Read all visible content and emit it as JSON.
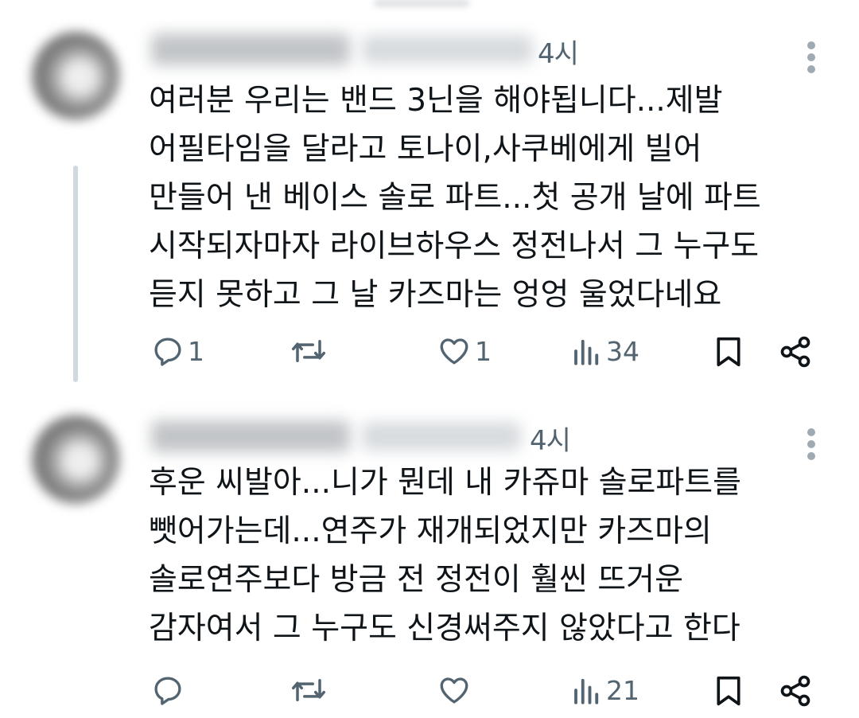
{
  "tweets": [
    {
      "time": "4시",
      "text_lines": [
        "여러분 우리는 밴드 3닌을 해야됩니다...제발",
        "어필타임을 달라고 토나이,사쿠베에게 빌어",
        "만들어 낸 베이스 솔로 파트...첫 공개 날에 파트",
        "시작되자마자 라이브하우스 정전나서 그 누구도",
        "듣지 못하고 그 날 카즈마는 엉엉 울었다네요"
      ],
      "actions": {
        "reply_count": "1",
        "retweet_count": "",
        "like_count": "1",
        "views_count": "34"
      }
    },
    {
      "time": "4시",
      "text_lines": [
        "후운 씨발아...니가 뭔데 내 카쥬마 솔로파트를",
        "뺏어가는데...연주가 재개되었지만 카즈마의",
        "솔로연주보다 방금 전 정전이 훨씬 뜨거운",
        "감자여서 그 누구도 신경써주지 않았다고 한다"
      ],
      "actions": {
        "reply_count": "",
        "retweet_count": "",
        "like_count": "",
        "views_count": "21"
      }
    }
  ],
  "icons": {
    "reply": "reply-icon",
    "retweet": "retweet-icon",
    "like": "heart-icon",
    "views": "views-icon",
    "bookmark": "bookmark-icon",
    "share": "share-icon",
    "more": "more-icon"
  },
  "colors": {
    "text": "#0f1419",
    "secondary": "#536471",
    "thread_line": "#cfd9de"
  }
}
